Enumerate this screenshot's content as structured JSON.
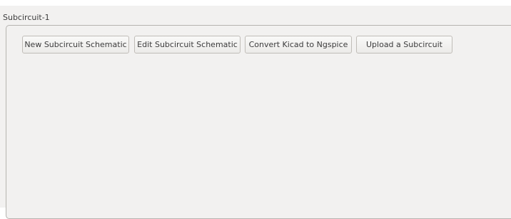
{
  "groupbox": {
    "title": "Subcircuit-1"
  },
  "toolbar": {
    "buttons": [
      {
        "label": "New Subcircuit Schematic"
      },
      {
        "label": "Edit Subcircuit Schematic"
      },
      {
        "label": "Convert Kicad to Ngspice"
      },
      {
        "label": "Upload a Subcircuit"
      }
    ]
  }
}
